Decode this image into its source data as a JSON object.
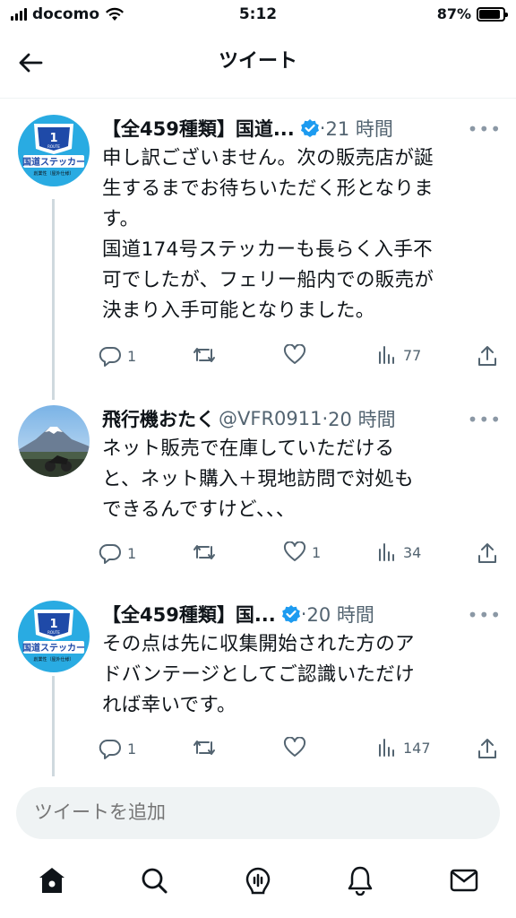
{
  "status": {
    "carrier": "docomo",
    "time": "5:12",
    "battery": "87%",
    "battery_level": 0.87
  },
  "header": {
    "title": "ツイート"
  },
  "tweets": [
    {
      "name": "【全459種類】国道...",
      "handle": "",
      "verified": true,
      "time": "21 時間",
      "body": "申し訳ございません。次の販売店が誕\n生するまでお待ちいただく形となりま\nす。\n国道174号ステッカーも長らく入手不\n可でしたが、フェリー船内での販売が\n決まり入手可能となりました。",
      "replies": "1",
      "retweets": "",
      "likes": "",
      "views": "77",
      "avatar_icon": "route-sticker-avatar"
    },
    {
      "name": "飛行機おたく",
      "handle": "@VFR0911",
      "verified": false,
      "time": "20 時間",
      "body": "ネット販売で在庫していただける\nと、ネット購入＋現地訪問で対処も\nできるんですけど、、、",
      "replies": "1",
      "retweets": "",
      "likes": "1",
      "views": "34",
      "avatar_icon": "mount-fuji-motorcycle-avatar"
    },
    {
      "name": "【全459種類】国...",
      "handle": "",
      "verified": true,
      "time": "20 時間",
      "body": "その点は先に収集開始された方のア\nドバンテージとしてご認識いただけ\nれば幸いです。",
      "replies": "1",
      "retweets": "",
      "likes": "",
      "views": "147",
      "avatar_icon": "route-sticker-avatar"
    }
  ],
  "avatar_text": {
    "route_number": "1",
    "route_word": "ROUTE",
    "title": "国道ステッカー",
    "subtitle": "創業性（屋外仕様）"
  },
  "reply": {
    "placeholder": "ツイートを追加"
  },
  "tabs": [
    "home-icon",
    "search-icon",
    "spaces-icon",
    "notifications-icon",
    "messages-icon"
  ],
  "colors": {
    "accent": "#1d9bf0",
    "text": "#0f1419",
    "secondary": "#536471",
    "avatar_bg": "#29abe2"
  }
}
